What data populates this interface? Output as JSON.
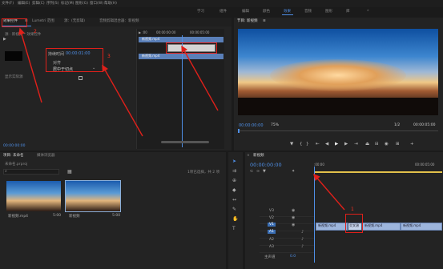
{
  "menu": [
    "文件(F)",
    "编辑(E)",
    "剪辑(C)",
    "序列(S)",
    "标记(M)",
    "图形(G)",
    "窗口(W)",
    "帮助(H)"
  ],
  "workspaces": [
    "学习",
    "组件",
    "编辑",
    "颜色",
    "效果",
    "音频",
    "图形",
    "库"
  ],
  "ws_more": "»",
  "ec": {
    "tab_active": "效果控件",
    "tab_menu": "≡",
    "tabs": [
      "Lumetri 范围",
      "源：(无剪辑)",
      "音频剪辑混合器：新视频"
    ],
    "clip_label": "源 · 新视频 * 效果控件",
    "time_label": "持续时间",
    "time_value": "00:00:01:00",
    "align_label": "对齐",
    "align_value": "居中于切点",
    "flip_label": "显示实际源",
    "tl_start": "▶ :00",
    "tl_t1": "00:00:00:00",
    "tl_t2": "00:00:05:00",
    "clip1": "新视频.mp4",
    "clip2": "新视频.mp4",
    "timecode": "00:00:00:00"
  },
  "program": {
    "tab": "节目: 新视频",
    "tab_menu": "≡",
    "timecode": "00:00:00:00",
    "zoom": "75%",
    "fraction": "1/2",
    "duration": "00:00:05:00"
  },
  "project": {
    "tabs": [
      "项目: 未命名",
      "媒体浏览器"
    ],
    "file": "未命名.prproj",
    "search_placeholder": "",
    "selected": "1项已选择，共 2 项",
    "items": [
      {
        "name": "新视频.mp4",
        "dur": "5:00"
      },
      {
        "name": "新视频",
        "dur": "5:00"
      }
    ]
  },
  "timeline": {
    "tab": "新视频",
    "timecode": "00:00:00:00",
    "ruler": [
      ":00:00",
      "00:00:05:00"
    ],
    "tracks": [
      {
        "name": "V3"
      },
      {
        "name": "V2"
      },
      {
        "name": "V1",
        "active": true
      },
      {
        "name": "A1",
        "active": true
      },
      {
        "name": "A2"
      },
      {
        "name": "A3"
      }
    ],
    "v1_clip_a": "新视频.mp4",
    "v1_clip_b": "新视频.mp4",
    "v1_clip_c": "新视频.mp4",
    "transition": "交叉溶",
    "master": "主声道",
    "master_val": "0.0"
  },
  "annotations": {
    "n1": "1",
    "n2": "2",
    "n3": "3"
  },
  "colors": {
    "accent": "#4f8fe6",
    "annotation": "#e0201a",
    "panel": "#232323"
  }
}
